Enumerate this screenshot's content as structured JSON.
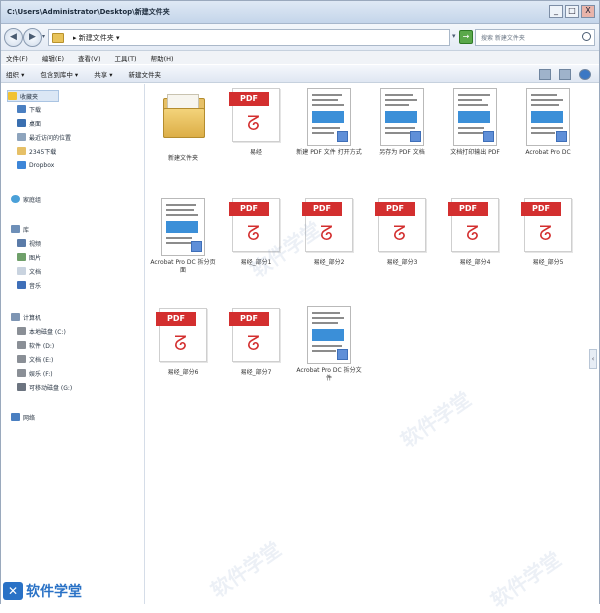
{
  "window": {
    "title": "C:\\Users\\Administrator\\Desktop\\新建文件夹",
    "buttons": {
      "minimize": "_",
      "maximize": "□",
      "close": "X"
    }
  },
  "address": {
    "crumb": "▸ 新建文件夹 ▾",
    "search_placeholder": "搜索 新建文件夹"
  },
  "menu": [
    "文件(F)",
    "编辑(E)",
    "查看(V)",
    "工具(T)",
    "帮助(H)"
  ],
  "toolbar": [
    "组织 ▾",
    "包含到库中 ▾",
    "共享 ▾",
    "新建文件夹"
  ],
  "navpane": {
    "favorites": [
      "收藏夹",
      "下载",
      "桌面",
      "最近访问的位置",
      "2345下载",
      "Dropbox"
    ],
    "homegroup": "家庭组",
    "libraries": [
      "库",
      "视频",
      "图片",
      "文档",
      "音乐"
    ],
    "computer": [
      "计算机",
      "本地磁盘 (C:)",
      "软件 (D:)",
      "文档 (E:)",
      "娱乐 (F:)",
      "可移动磁盘 (G:)"
    ],
    "network": "网络"
  },
  "files": [
    {
      "type": "folder",
      "name": "新建文件夹"
    },
    {
      "type": "pdf",
      "name": "易经"
    },
    {
      "type": "doc",
      "name": "新建 PDF 文件 打开方式"
    },
    {
      "type": "doc",
      "name": "另存为 PDF 文档"
    },
    {
      "type": "doc",
      "name": "文档打印输出 PDF"
    },
    {
      "type": "doc",
      "name": "Acrobat Pro DC"
    },
    {
      "type": "doc",
      "name": "Acrobat Pro DC 拆分页面"
    },
    {
      "type": "pdf",
      "name": "易经_部分1"
    },
    {
      "type": "pdf",
      "name": "易经_部分2"
    },
    {
      "type": "pdf",
      "name": "易经_部分3"
    },
    {
      "type": "pdf",
      "name": "易经_部分4"
    },
    {
      "type": "pdf",
      "name": "易经_部分5"
    },
    {
      "type": "pdf",
      "name": "易经_部分6"
    },
    {
      "type": "pdf",
      "name": "易经_部分7"
    },
    {
      "type": "doc",
      "name": "Acrobat Pro DC 拆分文件"
    }
  ],
  "pdf_badge": "PDF",
  "brand": {
    "logo": "✕",
    "text": "软件学堂"
  },
  "watermark": "软件学堂"
}
